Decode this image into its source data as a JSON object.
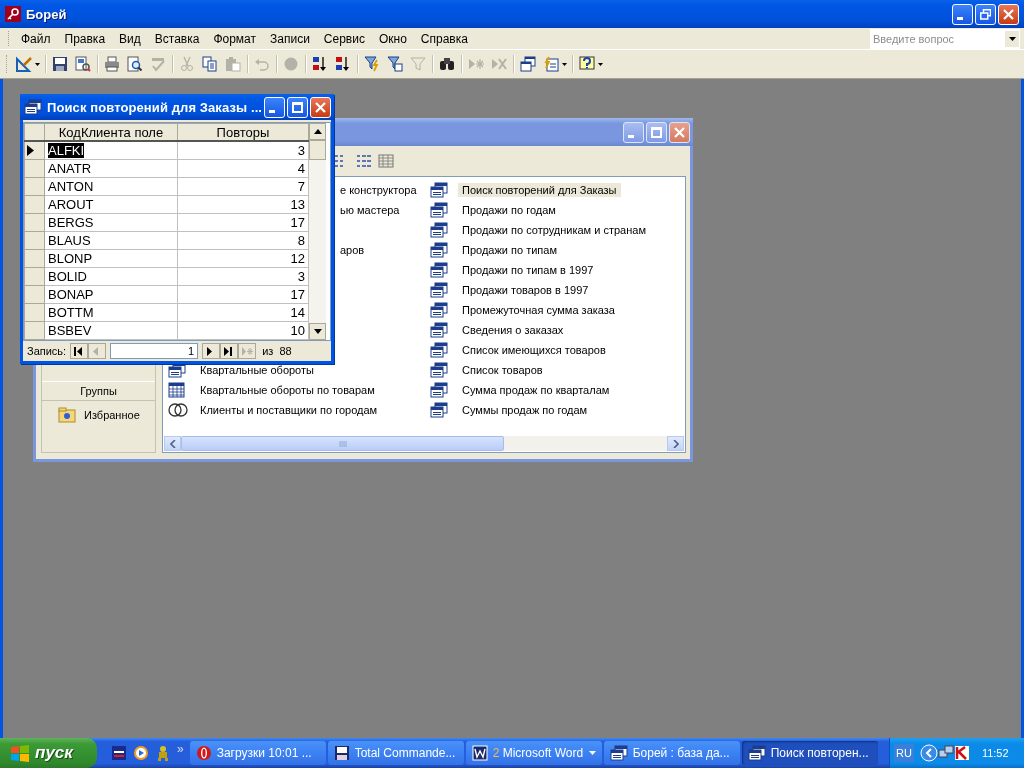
{
  "window": {
    "title": "Борей"
  },
  "menu": [
    "Файл",
    "Правка",
    "Вид",
    "Вставка",
    "Формат",
    "Записи",
    "Сервис",
    "Окно",
    "Справка"
  ],
  "help_box": {
    "placeholder": "Введите вопрос"
  },
  "toolbar": [
    {
      "disabled": false
    },
    {
      "disabled": false
    },
    {
      "disabled": false
    },
    {
      "disabled": false
    },
    {
      "disabled": false
    },
    {
      "disabled": true
    },
    {
      "disabled": true
    },
    {
      "disabled": false
    },
    {
      "disabled": true
    },
    {
      "disabled": true
    },
    {
      "disabled": true
    },
    {
      "disabled": false
    },
    {
      "disabled": false
    },
    {
      "disabled": false
    },
    {
      "disabled": false
    },
    {
      "disabled": true
    },
    {
      "disabled": false
    },
    {
      "disabled": true
    },
    {
      "disabled": true
    },
    {
      "disabled": false
    },
    {
      "disabled": false
    },
    {
      "disabled": false
    }
  ],
  "db_window": {
    "groups_button": "Группы",
    "groups": [
      {
        "label": "Избранное"
      }
    ],
    "rows": [
      {
        "left": {
          "kind": "clipped",
          "label": "е конструктора"
        },
        "right": {
          "kind": "select",
          "label": "Поиск повторений для Заказы",
          "selected": true
        }
      },
      {
        "left": {
          "kind": "clipped",
          "label": "ью мастера"
        },
        "right": {
          "kind": "select",
          "label": "Продажи по годам",
          "selected": false
        }
      },
      {
        "right": {
          "kind": "select",
          "label": "Продажи по сотрудникам и странам",
          "selected": false
        }
      },
      {
        "left": {
          "kind": "clipped",
          "label": "аров"
        },
        "right": {
          "kind": "select",
          "label": "Продажи по типам",
          "selected": false
        }
      },
      {
        "right": {
          "kind": "select",
          "label": "Продажи по типам в 1997",
          "selected": false
        }
      },
      {
        "right": {
          "kind": "select",
          "label": "Продажи товаров в 1997",
          "selected": false
        }
      },
      {
        "right": {
          "kind": "select",
          "label": "Промежуточная сумма заказа",
          "selected": false
        }
      },
      {
        "right": {
          "kind": "select",
          "label": "Сведения о заказах",
          "selected": false
        }
      },
      {
        "right": {
          "kind": "select",
          "label": "Список имеющихся товаров",
          "selected": false
        }
      },
      {
        "left": {
          "kind": "select",
          "label": "Квартальные обороты"
        },
        "right": {
          "kind": "select",
          "label": "Список товаров",
          "selected": false
        }
      },
      {
        "left": {
          "kind": "crosstab",
          "label": "Квартальные обороты по товарам"
        },
        "right": {
          "kind": "select",
          "label": "Сумма продаж по кварталам",
          "selected": false
        }
      },
      {
        "left": {
          "kind": "union",
          "label": "Клиенты и поставщики по городам"
        },
        "right": {
          "kind": "select",
          "label": "Суммы продаж по годам",
          "selected": false
        }
      }
    ]
  },
  "query_window": {
    "title": "Поиск повторений для Заказы ...",
    "columns": [
      "КодКлиента поле",
      "Повторы"
    ],
    "rows": [
      {
        "code": "ALFKI",
        "count": "3",
        "current": true
      },
      {
        "code": "ANATR",
        "count": "4",
        "current": false
      },
      {
        "code": "ANTON",
        "count": "7",
        "current": false
      },
      {
        "code": "AROUT",
        "count": "13",
        "current": false
      },
      {
        "code": "BERGS",
        "count": "17",
        "current": false
      },
      {
        "code": "BLAUS",
        "count": "8",
        "current": false
      },
      {
        "code": "BLONP",
        "count": "12",
        "current": false
      },
      {
        "code": "BOLID",
        "count": "3",
        "current": false
      },
      {
        "code": "BONAP",
        "count": "17",
        "current": false
      },
      {
        "code": "BOTTM",
        "count": "14",
        "current": false
      },
      {
        "code": "BSBEV",
        "count": "10",
        "current": false
      }
    ],
    "navigator": {
      "label": "Запись:",
      "record": "1",
      "of": "из",
      "total": "88",
      "buttons": [
        {
          "disabled": false
        },
        {
          "disabled": true
        },
        {
          "disabled": false
        },
        {
          "disabled": false
        },
        {
          "disabled": true
        }
      ]
    }
  },
  "taskbar": {
    "start": "пуск",
    "more": "»",
    "tasks": [
      {
        "label": "Загрузки 10:01 ...",
        "active": false
      },
      {
        "label": "Total Commande...",
        "active": false
      },
      {
        "count": "2",
        "label": "Microsoft Word",
        "active": false
      },
      {
        "label": "Борей : база да...",
        "active": false
      },
      {
        "label": "Поиск повторен...",
        "active": true
      }
    ],
    "language": "RU",
    "clock": "11:52"
  }
}
